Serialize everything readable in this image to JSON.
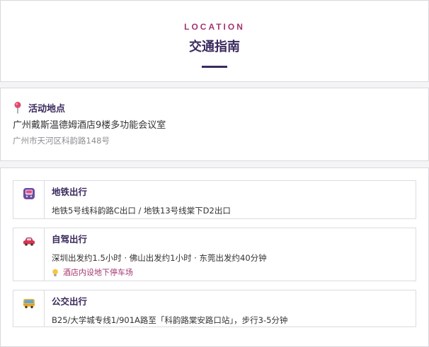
{
  "header": {
    "eyebrow": "LOCATION",
    "title": "交通指南"
  },
  "venue": {
    "label": "活动地点",
    "name": "广州戴斯温德姆酒店9楼多功能会议室",
    "address": "广州市天河区科韵路148号",
    "icon": "map-pin-icon"
  },
  "routes": [
    {
      "icon": "metro-icon",
      "title": "地铁出行",
      "desc": "地铁5号线科韵路C出口 / 地铁13号线棠下D2出口"
    },
    {
      "icon": "car-icon",
      "title": "自驾出行",
      "desc": "深圳出发约1.5小时 · 佛山出发约1小时 · 东莞出发约40分钟",
      "note": "酒店内设地下停车场",
      "note_icon": "lightbulb-icon"
    },
    {
      "icon": "bus-icon",
      "title": "公交出行",
      "desc": "B25/大学城专线1/901A路至「科韵路棠安路口站」，步行3-5分钟"
    }
  ],
  "colors": {
    "accent": "#a3366f",
    "heading": "#3b2a5e",
    "border": "#d9d9de",
    "muted": "#8e8e93"
  }
}
